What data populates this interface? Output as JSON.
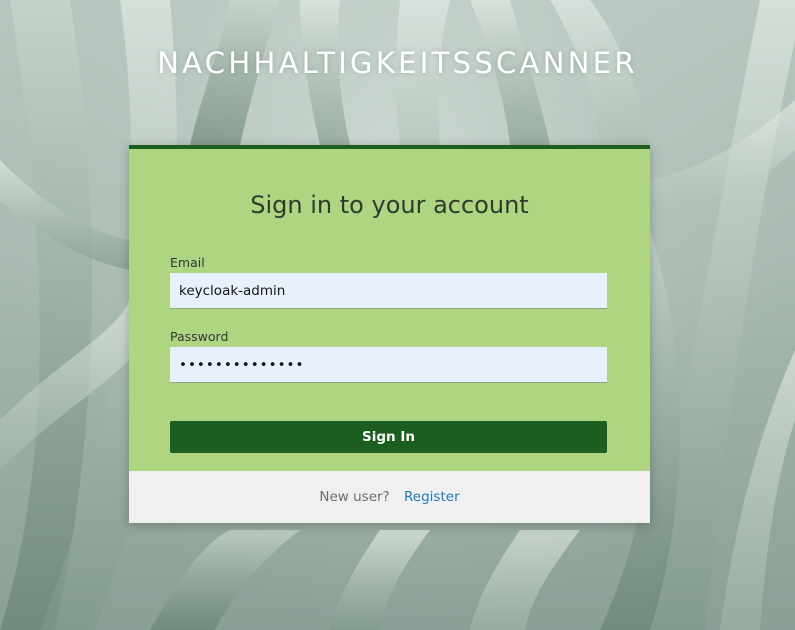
{
  "page": {
    "app_title": "NACHHALTIGKEITSSCANNER",
    "background": "blurred green agave leaves photo"
  },
  "login": {
    "heading": "Sign in to your account",
    "email_label": "Email",
    "email_value": "keycloak-admin",
    "password_label": "Password",
    "password_value": "••••••••••••••",
    "signin_label": "Sign In"
  },
  "footer": {
    "new_user_text": "New user?",
    "register_label": "Register"
  },
  "colors": {
    "card_background": "#aed581",
    "card_top_border": "#1b5e20",
    "button_background": "#1b5e20",
    "input_background": "#e8f0fe",
    "footer_background": "#f0f0f0",
    "link": "#1f7ab8"
  }
}
